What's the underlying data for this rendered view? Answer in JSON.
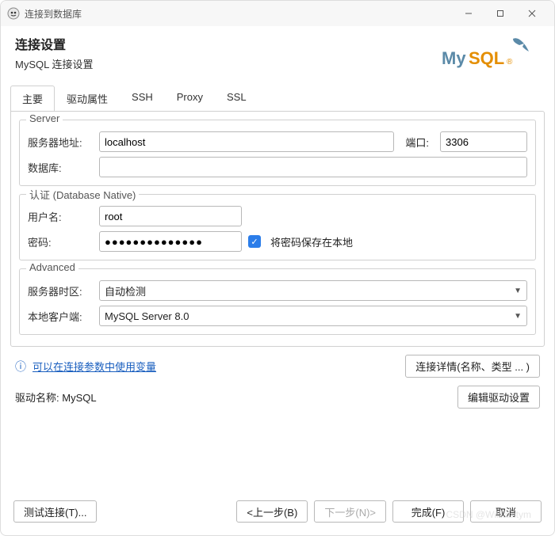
{
  "window": {
    "title": "连接到数据库"
  },
  "header": {
    "title": "连接设置",
    "subtitle": "MySQL 连接设置",
    "logo_text": "MySQL"
  },
  "tabs": [
    {
      "label": "主要",
      "active": true
    },
    {
      "label": "驱动属性",
      "active": false
    },
    {
      "label": "SSH",
      "active": false
    },
    {
      "label": "Proxy",
      "active": false
    },
    {
      "label": "SSL",
      "active": false
    }
  ],
  "server": {
    "legend": "Server",
    "host_label": "服务器地址:",
    "host_value": "localhost",
    "port_label": "端口:",
    "port_value": "3306",
    "db_label": "数据库:",
    "db_value": ""
  },
  "auth": {
    "legend": "认证 (Database Native)",
    "user_label": "用户名:",
    "user_value": "root",
    "password_label": "密码:",
    "password_value": "●●●●●●●●●●●●●●",
    "save_password_label": "将密码保存在本地",
    "save_password_checked": true
  },
  "advanced": {
    "legend": "Advanced",
    "tz_label": "服务器时区:",
    "tz_value": "自动检测",
    "client_label": "本地客户端:",
    "client_value": "MySQL Server 8.0"
  },
  "info": {
    "link_text": "可以在连接参数中使用变量",
    "details_button": "连接详情(名称、类型 ... )"
  },
  "driver": {
    "name_label": "驱动名称:",
    "name_value": "MySQL",
    "edit_button": "编辑驱动设置"
  },
  "footer": {
    "test": "测试连接(T)...",
    "back": "<上一步(B)",
    "next": "下一步(N)>",
    "finish": "完成(F)",
    "cancel": "取消"
  },
  "watermark": "CSDN @Williamtym"
}
